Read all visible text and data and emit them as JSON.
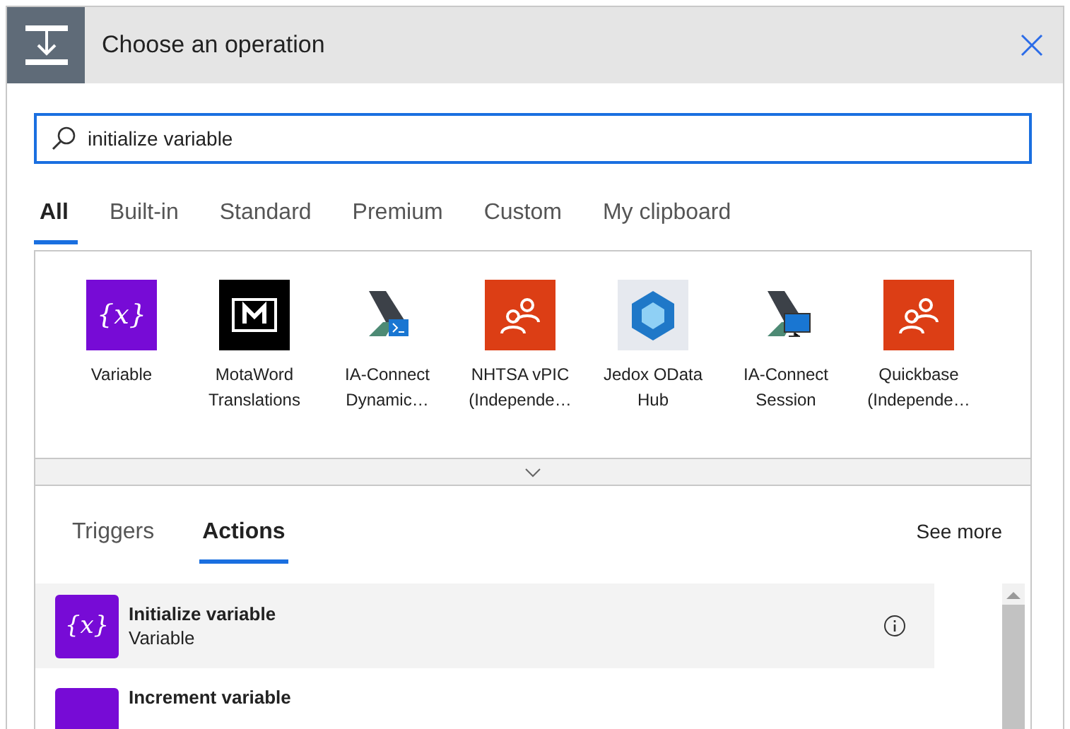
{
  "dialog": {
    "title": "Choose an operation"
  },
  "search": {
    "value": "initialize variable"
  },
  "category_tabs": [
    {
      "label": "All",
      "selected": true
    },
    {
      "label": "Built-in",
      "selected": false
    },
    {
      "label": "Standard",
      "selected": false
    },
    {
      "label": "Premium",
      "selected": false
    },
    {
      "label": "Custom",
      "selected": false
    },
    {
      "label": "My clipboard",
      "selected": false
    }
  ],
  "connectors": [
    {
      "kind": "variable",
      "icon_text": "{x}",
      "name": "Variable"
    },
    {
      "kind": "book",
      "name": "MotaWord Translations"
    },
    {
      "kind": "terminal",
      "name": "IA-Connect Dynamic…"
    },
    {
      "kind": "people",
      "name": "NHTSA vPIC (Independe…"
    },
    {
      "kind": "cube",
      "name": "Jedox OData Hub"
    },
    {
      "kind": "monitor",
      "name": "IA-Connect Session"
    },
    {
      "kind": "people",
      "name": "Quickbase (Independe…"
    }
  ],
  "result_tabs": [
    {
      "label": "Triggers",
      "selected": false
    },
    {
      "label": "Actions",
      "selected": true
    }
  ],
  "see_more": "See more",
  "actions": [
    {
      "icon_text": "{x}",
      "title": "Initialize variable",
      "connector": "Variable",
      "selected": true
    },
    {
      "title": "Increment variable",
      "selected": false
    }
  ]
}
